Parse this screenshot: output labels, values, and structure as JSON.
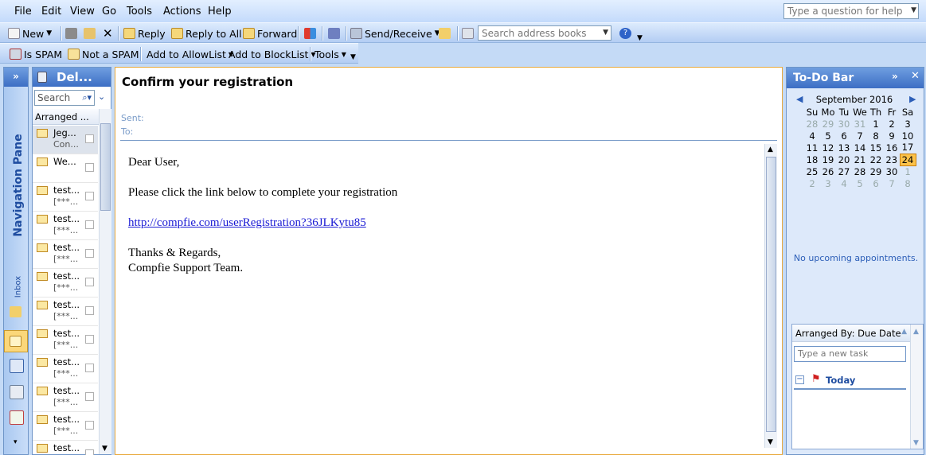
{
  "menu": {
    "file": "File",
    "edit": "Edit",
    "view": "View",
    "go": "Go",
    "tools": "Tools",
    "actions": "Actions",
    "help": "Help",
    "help_placeholder": "Type a question for help"
  },
  "toolbar": {
    "new": "New",
    "reply": "Reply",
    "reply_all": "Reply to All",
    "forward": "Forward",
    "send_receive": "Send/Receive",
    "search_books_placeholder": "Search address books"
  },
  "spambar": {
    "is_spam": "Is SPAM",
    "not_spam": "Not a SPAM",
    "allow": "Add to AllowList",
    "block": "Add to BlockList",
    "tools": "Tools"
  },
  "nav": {
    "label": "Navigation Pane",
    "inbox": "Inbox"
  },
  "list": {
    "folder": "Del...",
    "search_placeholder": "Search",
    "arranged": "Arranged ...",
    "rows": [
      {
        "t1": "Jeg...",
        "t2": "Con..."
      },
      {
        "t1": "We...",
        "t2": ""
      },
      {
        "t1": "test...",
        "t2": "[***..."
      },
      {
        "t1": "test...",
        "t2": "[***..."
      },
      {
        "t1": "test...",
        "t2": "[***..."
      },
      {
        "t1": "test...",
        "t2": "[***..."
      },
      {
        "t1": "test...",
        "t2": "[***..."
      },
      {
        "t1": "test...",
        "t2": "[***..."
      },
      {
        "t1": "test...",
        "t2": "[***..."
      },
      {
        "t1": "test...",
        "t2": "[***..."
      },
      {
        "t1": "test...",
        "t2": "[***..."
      },
      {
        "t1": "test...",
        "t2": ""
      }
    ]
  },
  "message": {
    "subject": "Confirm your registration",
    "sent_label": "Sent:",
    "to_label": "To:",
    "greeting": "Dear User,",
    "line1": "Please click the link below to complete your registration",
    "link": "http://compfie.com/userRegistration?36JLKytu85",
    "thanks": "Thanks & Regards,",
    "sign": "Compfie Support Team."
  },
  "todo": {
    "title": "To-Do Bar",
    "month": "September 2016",
    "weekdays": [
      "Su",
      "Mo",
      "Tu",
      "We",
      "Th",
      "Fr",
      "Sa"
    ],
    "weeks": [
      [
        "28",
        "29",
        "30",
        "31",
        "1",
        "2",
        "3"
      ],
      [
        "4",
        "5",
        "6",
        "7",
        "8",
        "9",
        "10"
      ],
      [
        "11",
        "12",
        "13",
        "14",
        "15",
        "16",
        "17"
      ],
      [
        "18",
        "19",
        "20",
        "21",
        "22",
        "23",
        "24"
      ],
      [
        "25",
        "26",
        "27",
        "28",
        "29",
        "30",
        "1"
      ],
      [
        "2",
        "3",
        "4",
        "5",
        "6",
        "7",
        "8"
      ]
    ],
    "no_appt": "No upcoming appointments.",
    "arranged": "Arranged By: Due Date",
    "new_task": "Type a new task",
    "today": "Today"
  }
}
